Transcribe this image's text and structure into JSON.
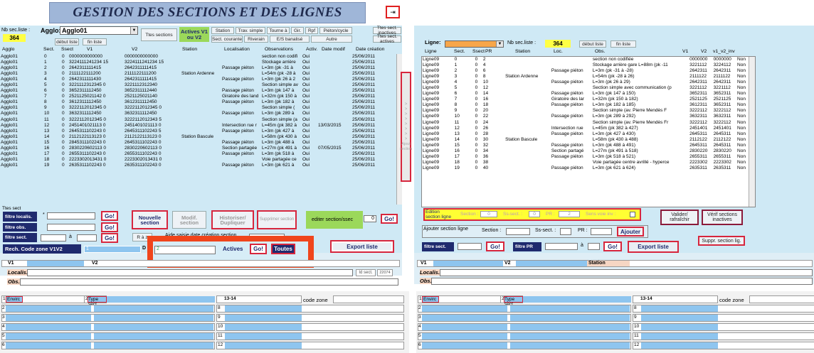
{
  "header": {
    "title": "GESTION DES SECTIONS ET DES LIGNES",
    "exit_icon": "door-exit-icon"
  },
  "left": {
    "nb_label": "Nb sec.liste :",
    "nb_value": "364",
    "agglo_label": "Agglo:",
    "agglo_value": "Agglo01",
    "ttes_sections": "Ttes sections",
    "actives_label": "Actives V1 ou V2",
    "filter_buttons_row1": [
      "Station",
      "Trav. simple",
      "Tourne à",
      "Gir.",
      "Rpf",
      "Piéton/cycle"
    ],
    "filter_buttons_row2": [
      "Sect. courante",
      "Riverain",
      "E/S banalisé",
      "Autre"
    ],
    "ttes_inactives": "Ttes sect. inactives",
    "ttes_actives": "Ttes sect. actives",
    "debut_liste": "début liste",
    "fin_liste": "fin liste",
    "columns": [
      "Agglo",
      "Sect.",
      "Ssect",
      "V1",
      "V2",
      "Station",
      "Localisation",
      "Observations",
      "Activ.",
      "Date modif",
      "Date création"
    ],
    "rows": [
      [
        "Agglo01",
        "0",
        "0",
        "0000000000000",
        "0000000000000",
        "",
        "",
        "section non codifi",
        "Oui",
        "",
        "25/06/2011"
      ],
      [
        "Agglo01",
        "1",
        "0",
        "3224111241234 15",
        "3224111241234 15",
        "",
        "",
        "Stockage arrière",
        "Oui",
        "",
        "25/06/2011"
      ],
      [
        "Agglo01",
        "2",
        "0",
        "2642311111415",
        "2642311111415",
        "",
        "Passage piéton",
        "L=3m (pk -31 à",
        "Oui",
        "",
        "25/06/2011"
      ],
      [
        "Agglo01",
        "3",
        "0",
        "2111122111200",
        "2111122111200",
        "Station Ardenne",
        "",
        "L=54m (pk -28 à",
        "Oui",
        "",
        "25/06/2011"
      ],
      [
        "Agglo01",
        "4",
        "0",
        "2642311111430",
        "2642311111415",
        "",
        "Passage piéton",
        "L=3m (pk 26 à 2",
        "Oui",
        "",
        "25/06/2011"
      ],
      [
        "Agglo01",
        "5",
        "0",
        "3221112312345 0",
        "3221112312340",
        "",
        "",
        "Section simple av",
        "Oui",
        "",
        "25/06/2011"
      ],
      [
        "Agglo01",
        "6",
        "0",
        "3652311112450",
        "3652311112440",
        "",
        "Passage piéton",
        "L=3m (pk 147 à",
        "Oui",
        "",
        "25/06/2011"
      ],
      [
        "Agglo01",
        "7",
        "0",
        "2521125021142 0",
        "2521125021140",
        "",
        "Giratoire des land",
        "L=32m (pk 150 à",
        "Oui",
        "",
        "25/06/2011"
      ],
      [
        "Agglo01",
        "8",
        "0",
        "3612311112450",
        "3612311112450",
        "",
        "Passage piéton",
        "L=3m (pk 182 à",
        "Oui",
        "",
        "25/06/2011"
      ],
      [
        "Agglo01",
        "9",
        "0",
        "3222112012345 0",
        "3222112012345 0",
        "",
        "",
        "Section simple (",
        "Oui",
        "",
        "25/06/2011"
      ],
      [
        "Agglo01",
        "10",
        "0",
        "3632311112450",
        "3632311112450",
        "",
        "Passage piéton",
        "L=3m (pk 289 à",
        "Oui",
        "",
        "25/06/2011"
      ],
      [
        "Agglo01",
        "11",
        "0",
        "3222112012345 0",
        "3222112012343 5",
        "",
        "",
        "Section simple (a",
        "Oui",
        "",
        "25/06/2011"
      ],
      [
        "Agglo01",
        "12",
        "0",
        "2451401021113 0",
        "2451401021113 0",
        "",
        "Intersection rue r",
        "L=45m (pk 382 à",
        "Oui",
        "13/03/2015",
        "25/06/2011"
      ],
      [
        "Agglo01",
        "13",
        "0",
        "2645311102243 0",
        "2645311102243 5",
        "",
        "Passage piéton",
        "L=3m (pk 427 à",
        "Oui",
        "",
        "25/06/2011"
      ],
      [
        "Agglo01",
        "14",
        "0",
        "2112122113123 0",
        "2112122113123 0",
        "Station Bascule",
        "",
        "L=58m (pk 430 à",
        "Oui",
        "",
        "25/06/2011"
      ],
      [
        "Agglo01",
        "15",
        "0",
        "2845311102243 0",
        "2645311102243 0",
        "",
        "Passage piéton",
        "L=3m (pk 488 à",
        "Oui",
        "",
        "25/06/2011"
      ],
      [
        "Agglo01",
        "16",
        "0",
        "2830220602113 0",
        "2830220602113 0",
        "",
        "Section partagée",
        "L=27m (pk 491 à",
        "Oui",
        "07/05/2015",
        "25/06/2011"
      ],
      [
        "Agglo01",
        "17",
        "0",
        "2655311102243 0",
        "2655311102243 0",
        "",
        "Passage piéton",
        "L=3m (pk 518 à",
        "Oui",
        "",
        "25/06/2011"
      ],
      [
        "Agglo01",
        "18",
        "0",
        "2223302013431 0",
        "2223302013431 0",
        "",
        "",
        "Voie partagée ce",
        "Oui",
        "",
        "25/06/2011"
      ],
      [
        "Agglo01",
        "19",
        "0",
        "2635311102243 0",
        "2635311102243 0",
        "",
        "Passage piéton",
        "L=3m (pk 621 à",
        "Oui",
        "",
        "25/06/2011"
      ]
    ],
    "ttes_sect": "Ttes sect",
    "filtre_localis": "filtre localis.",
    "filtre_obs": "filtre obs.",
    "filtre_sect": "filtre sect.",
    "a": "à",
    "go": "Go!",
    "star": "*",
    "nouvelle_section": "Nouvelle section",
    "modif_section": "Modif. section",
    "historiser": "Historiser/ Dupliquer",
    "supprimer": "Supprimer section",
    "editer": "editer section/ssec",
    "editer_value": "0",
    "raz": "R à z",
    "aide_saisie": "Aide saisie date création section",
    "rech_code": "Rech. Code zone V1V2",
    "rech_val": "1",
    "field_d": "D",
    "field_2": "2",
    "actives_btn": "Actives",
    "toutes_btn": "Toutes",
    "export": "Export liste",
    "v1": "V1",
    "v2": "V2",
    "localis": "Localis.",
    "obs": "Obs.",
    "id_sect": "Id sect.",
    "id_sect_val": "22074"
  },
  "mid": {
    "ajout_section": "Ajout section",
    "arrows": [
      ">",
      ">",
      ">",
      ">",
      ">",
      ">",
      ">",
      ">"
    ]
  },
  "right": {
    "ligne_label": "Ligne:",
    "nb_label": "Nb sec.liste :",
    "nb_value": "364",
    "debut_liste": "début liste",
    "fin_liste": "fin liste",
    "columns": [
      "Ligne",
      "Sect.",
      "Ssect",
      "PR",
      "Station",
      "Loc.",
      "Obs.",
      "V1",
      "V2",
      "v1_v2_inv"
    ],
    "rows": [
      [
        "Ligne09",
        "0",
        "0",
        "2",
        "",
        "",
        "section non codifiée",
        "0000000",
        "0000000",
        "Non"
      ],
      [
        "Ligne09",
        "1",
        "0",
        "4",
        "",
        "",
        "Stockage arrière gare L=88m (pk -11",
        "3221112",
        "3224112",
        "Non"
      ],
      [
        "Ligne09",
        "2",
        "0",
        "6",
        "",
        "Passage piéton",
        "L=3m (pk -31 à -28)",
        "2642311",
        "2642311",
        "Non"
      ],
      [
        "Ligne09",
        "3",
        "0",
        "8",
        "Station Ardenne",
        "",
        "L=54m (pk -28 à 26)",
        "2111122",
        "2111122",
        "Non"
      ],
      [
        "Ligne09",
        "4",
        "0",
        "10",
        "",
        "Passage piéton",
        "L=3m (pk 26 à 29)",
        "2642311",
        "2642311",
        "Non"
      ],
      [
        "Ligne09",
        "5",
        "0",
        "12",
        "",
        "",
        "Section simple avec communication (p",
        "3221112",
        "3221112",
        "Non"
      ],
      [
        "Ligne09",
        "6",
        "0",
        "14",
        "",
        "Passage piéton",
        "L=3m (pk 147 à 150)",
        "3652311",
        "3652311",
        "Non"
      ],
      [
        "Ligne09",
        "7",
        "0",
        "16",
        "",
        "Giratoire des lar",
        "L=32m (pk 150 à 182)",
        "2521125",
        "2521125",
        "Non"
      ],
      [
        "Ligne09",
        "8",
        "0",
        "18",
        "",
        "Passage piéton",
        "L=3m (pk 182 à 185)",
        "3612311",
        "3652311",
        "Non"
      ],
      [
        "Ligne09",
        "9",
        "0",
        "20",
        "",
        "",
        "Section simple (av. Pierre Mendès F",
        "3222112",
        "3222112",
        "Non"
      ],
      [
        "Ligne09",
        "10",
        "0",
        "22",
        "",
        "Passage piéton",
        "L=3m (pk 289 à 292)",
        "3632311",
        "3632311",
        "Non"
      ],
      [
        "Ligne09",
        "11",
        "0",
        "24",
        "",
        "",
        "Section simple (av. Pierre Mendès Fr",
        "3222112",
        "3222112",
        "Non"
      ],
      [
        "Ligne09",
        "12",
        "0",
        "26",
        "",
        "Intersection rue",
        "L=45m (pk 382 à 427)",
        "2451401",
        "2451401",
        "Non"
      ],
      [
        "Ligne09",
        "13",
        "0",
        "28",
        "",
        "Passage piéton",
        "L=3m (pk 427 à 430)",
        "2645311",
        "2645311",
        "Non"
      ],
      [
        "Ligne09",
        "14",
        "0",
        "30",
        "Station Bascule",
        "",
        "L=58m (pk 430 à 488)",
        "2112122",
        "2112122",
        "Non"
      ],
      [
        "Ligne09",
        "15",
        "0",
        "32",
        "",
        "Passage piéton",
        "L=3m (pk 488 à 491)",
        "2645311",
        "2645311",
        "Non"
      ],
      [
        "Ligne09",
        "16",
        "0",
        "34",
        "",
        "Section partagé",
        "L=27m (pk 491 à 518)",
        "2830220",
        "2830220",
        "Non"
      ],
      [
        "Ligne09",
        "17",
        "0",
        "36",
        "",
        "Passage piéton",
        "L=3m (pk 518 à 521)",
        "2655311",
        "2655311",
        "Non"
      ],
      [
        "Ligne09",
        "18",
        "0",
        "38",
        "",
        "",
        "Voie partagée centre avrillé - hyperce",
        "2223302",
        "2223302",
        "Non"
      ],
      [
        "Ligne09",
        "19",
        "0",
        "40",
        "",
        "Passage piéton",
        "L=3m (pk 621 à 624)",
        "2635311",
        "2635311",
        "Non"
      ]
    ],
    "edition": "Edition section ligne",
    "section_lbl": "Section :",
    "section_val": "0",
    "ssect_lbl": "Ss-sect. :",
    "ssect_val": "0",
    "pr_lbl": "PR :",
    "pr_val": "2",
    "sens_voie": "Sens voie inv :",
    "valider": "Valider/ rafraîchir",
    "verif": "Vérif sections inactives",
    "ajouter_section_ligne": "Ajouter section ligne",
    "section2": "Section :",
    "ssect2": "Ss-sect. :",
    "pr2": "PR :",
    "ajouter": "Ajouter",
    "suppr": "Suppr. section lig.",
    "filtre_sect": "filtre sect.",
    "filtre_pr": "filtre PR",
    "a": "à",
    "go": "Go!",
    "export": "Export liste",
    "v1": "V1",
    "v2": "V2",
    "station": "Station",
    "localis": "Localis.",
    "obs": "Obs."
  },
  "bottom": {
    "envir": "Envirc",
    "type_sect": "Type sect.",
    "col_1314": "13-14",
    "code_zone": "code zone",
    "left_nums": [
      "1",
      "2",
      "3",
      "4",
      "5",
      "6",
      "7"
    ],
    "right_nums": [
      "8",
      "9",
      "10",
      "11",
      "12"
    ]
  }
}
